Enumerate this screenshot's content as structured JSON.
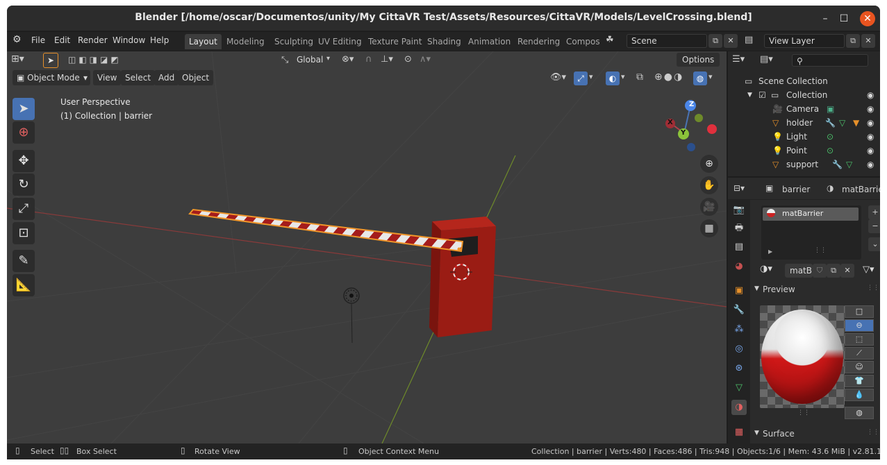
{
  "window": {
    "title": "Blender [/home/oscar/Documentos/unity/My CittaVR Test/Assets/Resources/CittaVR/Models/LevelCrossing.blend]",
    "minimize": "–",
    "maximize": "☐",
    "close": "✕"
  },
  "menu": [
    "File",
    "Edit",
    "Render",
    "Window",
    "Help"
  ],
  "workspaces": [
    "Layout",
    "Modeling",
    "Sculpting",
    "UV Editing",
    "Texture Paint",
    "Shading",
    "Animation",
    "Rendering",
    "Composit"
  ],
  "scene": {
    "label": "Scene",
    "view_layer": "View Layer"
  },
  "viewport": {
    "transform_orientation": "Global",
    "options": "Options",
    "mode": "Object Mode",
    "menus": [
      "View",
      "Select",
      "Add",
      "Object"
    ],
    "overlay_line1": "User Perspective",
    "overlay_line2": "(1) Collection | barrier",
    "gizmo": {
      "z": "Z",
      "x": "X",
      "y": "Y"
    }
  },
  "outliner": {
    "root": "Scene Collection",
    "collection": "Collection",
    "items": [
      "Camera",
      "holder",
      "Light",
      "Point",
      "support"
    ]
  },
  "properties": {
    "object": "barrier",
    "material": "matBarrier",
    "slot": "matBarrier",
    "mat_field": "matB",
    "preview": "Preview",
    "surface": "Surface"
  },
  "status": {
    "select": "Select",
    "box_select": "Box Select",
    "rotate": "Rotate View",
    "context": "Object Context Menu",
    "info": "Collection | barrier | Verts:480 | Faces:486 | Tris:948 | Objects:1/6 | Mem: 43.6 MiB | v2.81.16"
  },
  "colors": {
    "accent": "#4772b3",
    "orange": "#e6902a",
    "barrier_red": "#9a1c14",
    "close": "#e95420"
  }
}
